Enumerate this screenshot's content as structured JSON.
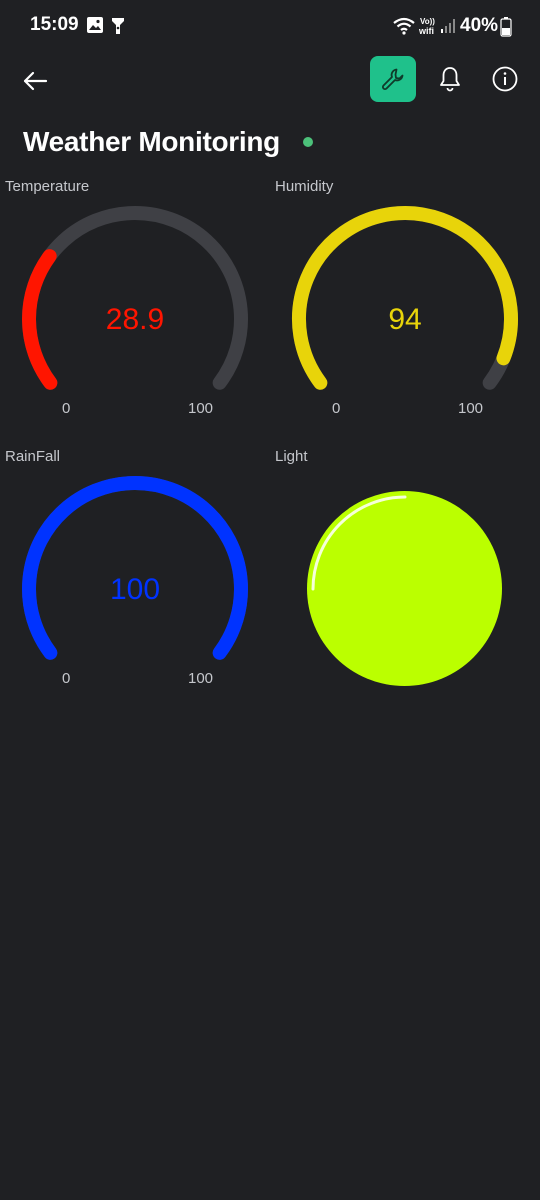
{
  "status_bar": {
    "time": "15:09",
    "battery": "40%",
    "icons": [
      "gallery-icon",
      "flashlight-icon",
      "wifi-icon",
      "vowifi-icon",
      "signal-icon",
      "battery-icon"
    ],
    "vowifi_top": "Vo))",
    "vowifi_bottom": "wifi"
  },
  "app_bar": {
    "back_icon": "arrow-left-icon",
    "settings_icon": "wrench-icon",
    "bell_icon": "bell-icon",
    "info_icon": "info-icon",
    "accent": "#1fc18b"
  },
  "page": {
    "title": "Weather Monitoring",
    "status_color": "#4cc17a"
  },
  "widgets": {
    "temperature": {
      "label": "Temperature",
      "value": "28.9",
      "min": "0",
      "max": "100",
      "color": "#ff1500",
      "level": 0.289
    },
    "humidity": {
      "label": "Humidity",
      "value": "94",
      "min": "0",
      "max": "100",
      "color": "#e8d40a",
      "level": 0.94
    },
    "rainfall": {
      "label": "RainFall",
      "value": "100",
      "min": "0",
      "max": "100",
      "color": "#0033ff",
      "level": 1.0
    },
    "light": {
      "label": "Light",
      "color": "#bbff00"
    }
  },
  "colors": {
    "background": "#1f2023",
    "gauge_track": "#3f4045"
  }
}
